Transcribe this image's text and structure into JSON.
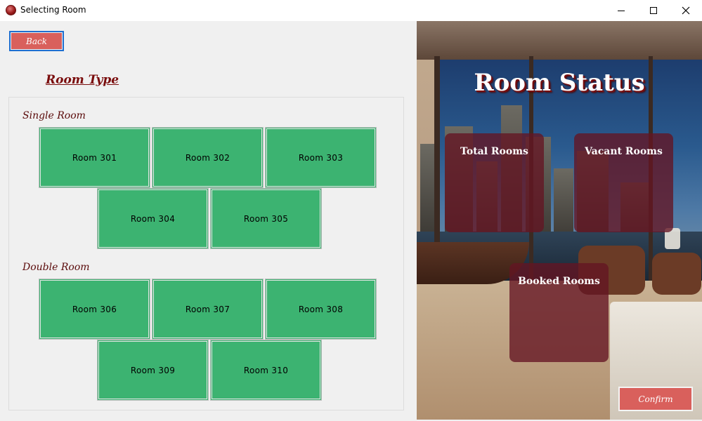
{
  "window": {
    "title": "Selecting Room"
  },
  "toolbar": {
    "back_label": "Back"
  },
  "room_type": {
    "title": "Room Type"
  },
  "sections": {
    "single": {
      "label": "Single Room"
    },
    "double": {
      "label": "Double Room"
    }
  },
  "rooms": {
    "r301": "Room 301",
    "r302": "Room 302",
    "r303": "Room 303",
    "r304": "Room 304",
    "r305": "Room 305",
    "r306": "Room 306",
    "r307": "Room 307",
    "r308": "Room 308",
    "r309": "Room 309",
    "r310": "Room 310"
  },
  "status": {
    "title": "Room Status",
    "total_label": "Total Rooms",
    "vacant_label": "Vacant Rooms",
    "booked_label": "Booked Rooms"
  },
  "actions": {
    "confirm_label": "Confirm"
  },
  "colors": {
    "room_button": "#3cb371",
    "accent_button": "#d9605c",
    "heading": "#7a0c0c",
    "status_card": "#641423"
  },
  "icons": {
    "app": "app-icon",
    "minimize": "minimize-icon",
    "maximize": "maximize-icon",
    "close": "close-icon"
  }
}
